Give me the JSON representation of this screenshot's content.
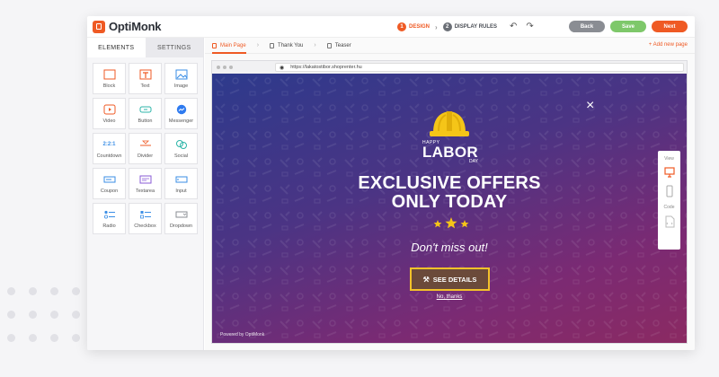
{
  "app": {
    "logo_text": "OptiMonk",
    "brand_color": "#ef5a24"
  },
  "steps": [
    {
      "num": "1",
      "label": "DESIGN",
      "state": "active"
    },
    {
      "num": "2",
      "label": "DISPLAY RULES",
      "state": "inactive"
    }
  ],
  "toolbar": {
    "undo_icon": "undo-icon",
    "redo_icon": "redo-icon",
    "back_label": "Back",
    "save_label": "Save",
    "next_label": "Next"
  },
  "left_panel": {
    "tabs": [
      {
        "label": "ELEMENTS",
        "active": true
      },
      {
        "label": "SETTINGS",
        "active": false
      }
    ],
    "elements": [
      {
        "label": "Block",
        "icon": "block-icon"
      },
      {
        "label": "Text",
        "icon": "text-icon"
      },
      {
        "label": "Image",
        "icon": "image-icon"
      },
      {
        "label": "Video",
        "icon": "video-icon"
      },
      {
        "label": "Button",
        "icon": "button-icon"
      },
      {
        "label": "Messenger",
        "icon": "messenger-icon"
      },
      {
        "label": "Countdown",
        "icon": "countdown-icon"
      },
      {
        "label": "Divider",
        "icon": "divider-icon"
      },
      {
        "label": "Social",
        "icon": "social-icon"
      },
      {
        "label": "Coupon",
        "icon": "coupon-icon"
      },
      {
        "label": "Textarea",
        "icon": "textarea-icon"
      },
      {
        "label": "Input",
        "icon": "input-icon"
      },
      {
        "label": "Radio",
        "icon": "radio-icon"
      },
      {
        "label": "Checkbox",
        "icon": "checkbox-icon"
      },
      {
        "label": "Dropdown",
        "icon": "dropdown-icon"
      }
    ]
  },
  "pages": {
    "tabs": [
      {
        "label": "Main Page",
        "active": true
      },
      {
        "label": "Thank You",
        "active": false
      },
      {
        "label": "Teaser",
        "active": false
      }
    ],
    "add_label": "+ Add new page"
  },
  "browser": {
    "url": "https://lakatostibor.shoprenter.hu"
  },
  "popup": {
    "happy": "HAPPY",
    "labor": "LABOR",
    "day": "DAY",
    "headline_line1": "EXCLUSIVE OFFERS",
    "headline_line2": "ONLY TODAY",
    "tagline": "Don't miss out!",
    "cta_label": "SEE DETAILS",
    "no_thanks": "No, thanks",
    "powered": "Powered by OptiMonk",
    "close_glyph": "×",
    "cta_border_color": "#f2c22a",
    "gradient_start": "#2d3a8c",
    "gradient_end": "#8b2a62"
  },
  "view_panel": {
    "view_label": "View",
    "code_label": "Code"
  }
}
